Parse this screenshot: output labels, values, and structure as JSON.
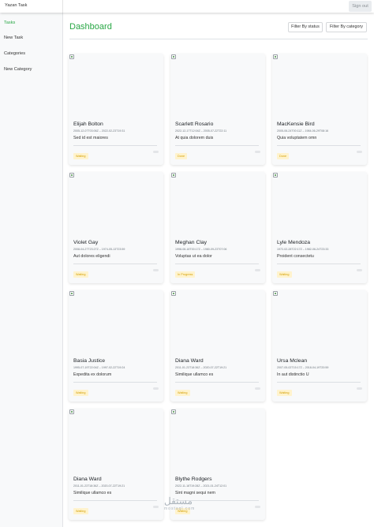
{
  "topbar": {
    "brand": "Yazan Task",
    "signout_label": "Sign out"
  },
  "sidebar": {
    "items": [
      {
        "label": "Tasks",
        "active": true
      },
      {
        "label": "New Task",
        "active": false
      },
      {
        "label": "Categories",
        "active": false
      },
      {
        "label": "New Category",
        "active": false
      }
    ]
  },
  "page": {
    "title": "Dashboard",
    "filter_status_label": "Filter By status",
    "filter_category_label": "Filter By category"
  },
  "cards": [
    {
      "name": "Elijah Bolton",
      "dates": "2005-12-07T03:06Z – 2022-02-23T19:31",
      "description": "Sed id est maiores",
      "status": "Waiting"
    },
    {
      "name": "Scarlett Rosario",
      "dates": "2022-12-17T12:04Z – 2005-07-22T22:11",
      "description": "At quia dolorem duis",
      "status": "Done"
    },
    {
      "name": "MacKensie Bird",
      "dates": "2005-06-24T00:11Z – 1984-06-29T08:16",
      "description": "Quia voluptatem omn",
      "status": "Done"
    },
    {
      "name": "Violet Gay",
      "dates": "2008-04-27T23:27Z – 1974-05-13T23:59",
      "description": "Aut dolores eligendi",
      "status": "Waiting"
    },
    {
      "name": "Meghan Clay",
      "dates": "1998-08-18T00:17Z – 1980-09-23T07:06",
      "description": "Voluptas ut ea dolor",
      "status": "In Progress"
    },
    {
      "name": "Lyle Mendoza",
      "dates": "1972-02-28T22:17Z – 1982-06-24T23:33",
      "description": "Proident consectetu",
      "status": "Waiting"
    },
    {
      "name": "Basia Justice",
      "dates": "1995-07-19T22:04Z – 1997-02-22T19:24",
      "description": "Expedita ex dolorum",
      "status": "Waiting"
    },
    {
      "name": "Diana Ward",
      "dates": "2011-01-23T18:36Z – 2020-07-22T19:21",
      "description": "Similique ullamco es",
      "status": "Waiting"
    },
    {
      "name": "Ursa Mclean",
      "dates": "2007-05-02T15:17Z – 2018-04-19T20:59",
      "description": "In aut distinctio U",
      "status": "Waiting"
    },
    {
      "name": "Diana Ward",
      "dates": "2011-01-23T18:36Z – 2020-07-22T19:21",
      "description": "Similique ullamco es",
      "status": "Waiting"
    },
    {
      "name": "Blythe Rodgers",
      "dates": "2022-11-18T19:28Z – 2021-01-24T12:01",
      "description": "Sint magni sequi nem",
      "status": "Waiting"
    }
  ],
  "watermark": {
    "arabic": "مستقل",
    "latin": "mostaql.com"
  },
  "colors": {
    "accent": "#28a745",
    "waiting_bg": "#fff3cd",
    "waiting_text": "#d39e00"
  }
}
